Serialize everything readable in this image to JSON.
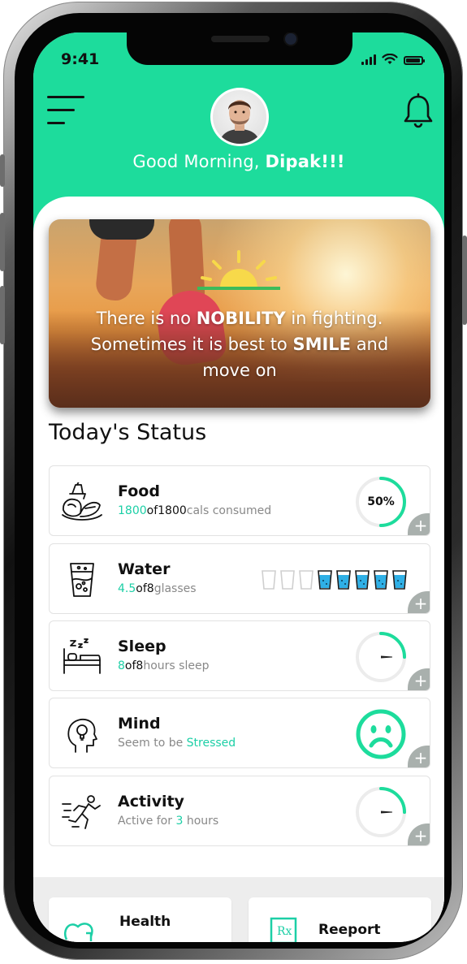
{
  "status_bar": {
    "time": "9:41"
  },
  "header": {
    "greeting_prefix": "Good Morning, ",
    "user_name": "Dipak!!!"
  },
  "quote": {
    "line1_pre": "There is no ",
    "line1_bold": "NOBILITY",
    "line1_post": " in fighting.",
    "line2_pre": "Sometimes it is best to ",
    "line2_bold": "SMILE",
    "line2_post": " and",
    "line3": "move on"
  },
  "section_title": "Today's Status",
  "status_cards": {
    "food": {
      "name": "Food",
      "consumed": "1800",
      "of": "of",
      "total": "1800",
      "unit": "cals consumed",
      "progress_label": "50%",
      "progress": 0.5
    },
    "water": {
      "name": "Water",
      "consumed": "4.5",
      "of": "of",
      "total": "8",
      "unit": "glasses",
      "glasses_total": 8,
      "glasses_empty": 3
    },
    "sleep": {
      "name": "Sleep",
      "consumed": "8",
      "of": "of",
      "total": "8",
      "unit": "hours sleep",
      "progress": 0.25
    },
    "mind": {
      "name": "Mind",
      "prefix": "Seem to be ",
      "state": "Stressed"
    },
    "activity": {
      "name": "Activity",
      "prefix": "Active for ",
      "value": "3",
      "suffix": " hours",
      "progress": 0.25
    }
  },
  "plus_label": "+",
  "bottom_cards": {
    "health": "Health",
    "report": "Reeport"
  },
  "colors": {
    "accent": "#1ddc9c",
    "highlight": "#1ccfa6",
    "water_fill": "#2fb0e6",
    "plus_bg": "#a9b0ad"
  }
}
